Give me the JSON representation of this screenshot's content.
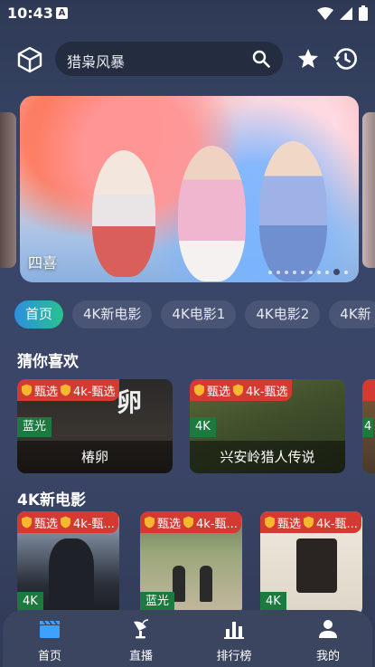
{
  "status_bar": {
    "time": "10:43",
    "notification_letter": "A"
  },
  "top_bar": {
    "search_text": "猎枭风暴",
    "icons": {
      "logo": "cube-icon",
      "search": "search-icon",
      "favorite": "star-icon",
      "history": "history-icon"
    }
  },
  "banner": {
    "title": "四喜",
    "dot_count": 10,
    "active_dot": 8
  },
  "tabs": [
    {
      "label": "首页",
      "active": true
    },
    {
      "label": "4K新电影",
      "active": false
    },
    {
      "label": "4K电影1",
      "active": false
    },
    {
      "label": "4K电影2",
      "active": false
    },
    {
      "label": "4K新",
      "active": false
    }
  ],
  "sections": {
    "guess": {
      "title": "猜你喜欢",
      "cards": [
        {
          "badge1": "甄选",
          "badge2": "4k-甄选",
          "quality": "蓝光",
          "caption": "椿卵"
        },
        {
          "badge1": "甄选",
          "badge2": "4k-甄选",
          "quality": "4K",
          "caption": "兴安岭猎人传说"
        },
        {
          "badge1": "",
          "badge2": "",
          "quality": "4",
          "caption": ""
        }
      ]
    },
    "new4k": {
      "title": "4K新电影",
      "cards": [
        {
          "badge1": "甄选",
          "badge2": "4k-甄...",
          "quality": "4K"
        },
        {
          "badge1": "甄选",
          "badge2": "4k-甄...",
          "quality": "蓝光"
        },
        {
          "badge1": "甄选",
          "badge2": "4k-甄...",
          "quality": "4K"
        }
      ]
    }
  },
  "bottom_nav": [
    {
      "label": "首页",
      "icon": "clapperboard-icon",
      "active": true
    },
    {
      "label": "直播",
      "icon": "satellite-dish-icon",
      "active": false
    },
    {
      "label": "排行榜",
      "icon": "bar-chart-icon",
      "active": false
    },
    {
      "label": "我的",
      "icon": "user-icon",
      "active": false
    }
  ],
  "colors": {
    "accent_blue": "#2d8fe0",
    "accent_green": "#27c28f",
    "badge_red": "#d43a32",
    "quality_green": "#1c7a3e"
  }
}
